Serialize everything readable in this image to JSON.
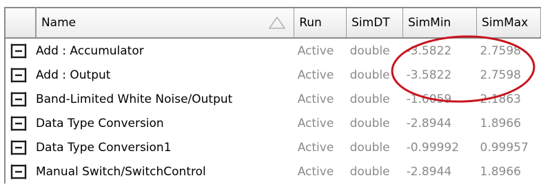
{
  "columns": [
    "Name",
    "Run",
    "SimDT",
    "SimMin",
    "SimMax"
  ],
  "sort_icon": "sort-ascending-triangle-icon",
  "row_icon": "signal-box-icon",
  "rows": [
    {
      "name": "Add : Accumulator",
      "run": "Active",
      "simdt": "double",
      "simmin": "-3.5822",
      "simmax": "2.7598"
    },
    {
      "name": "Add : Output",
      "run": "Active",
      "simdt": "double",
      "simmin": "-3.5822",
      "simmax": "2.7598"
    },
    {
      "name": "Band-Limited White Noise/Output",
      "run": "Active",
      "simdt": "double",
      "simmin": "-1.6059",
      "simmax": "2.1863"
    },
    {
      "name": "Data Type Conversion",
      "run": "Active",
      "simdt": "double",
      "simmin": "-2.8944",
      "simmax": "1.8966"
    },
    {
      "name": "Data Type Conversion1",
      "run": "Active",
      "simdt": "double",
      "simmin": "-0.99992",
      "simmax": "0.99957"
    },
    {
      "name": "Manual Switch/SwitchControl",
      "run": "Active",
      "simdt": "double",
      "simmin": "-2.8944",
      "simmax": "1.8966"
    }
  ],
  "colors": {
    "muted_text": "#8a8a8a",
    "annotation": "#c8141e",
    "header_border": "#8a8a8a"
  }
}
